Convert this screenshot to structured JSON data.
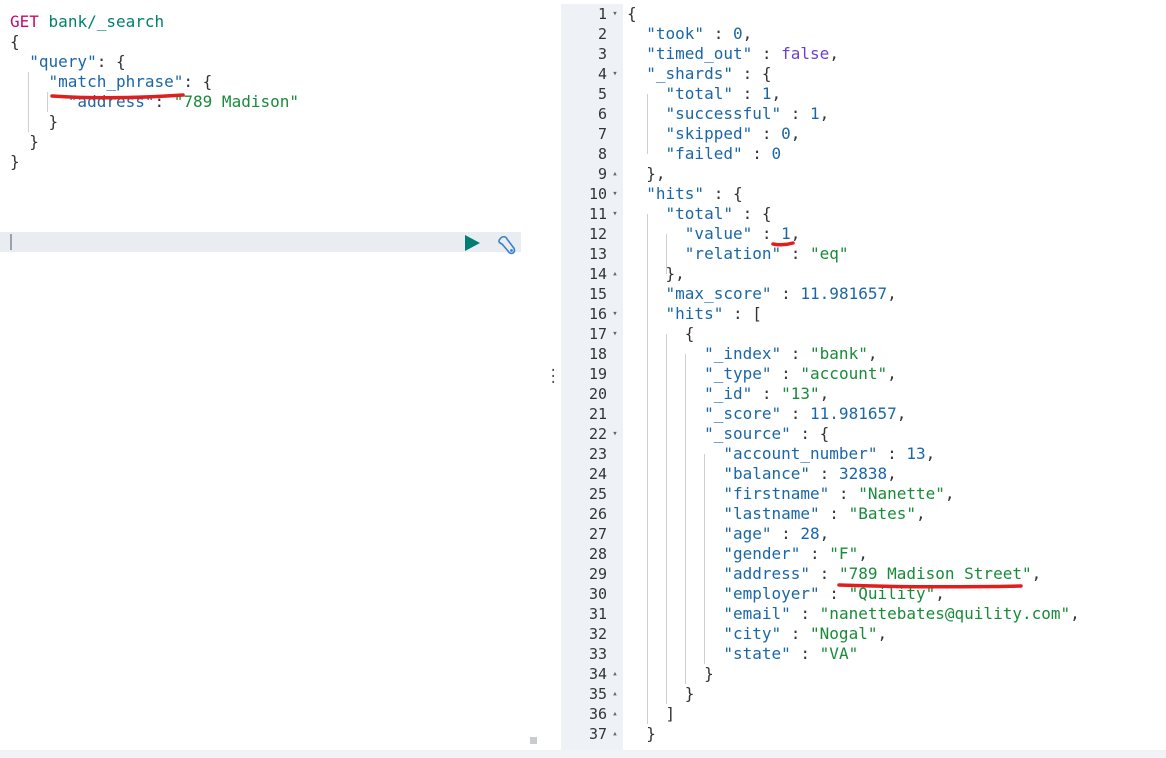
{
  "request": {
    "method": "GET",
    "path": "bank/_search",
    "lines": [
      [
        {
          "t": "{",
          "c": "punc"
        }
      ],
      [
        {
          "t": "  "
        },
        {
          "t": "\"query\"",
          "c": "key"
        },
        {
          "t": ": {",
          "c": "punc"
        }
      ],
      [
        {
          "t": "    "
        },
        {
          "t": "\"match_phrase\"",
          "c": "key"
        },
        {
          "t": ": {",
          "c": "punc"
        }
      ],
      [
        {
          "t": "      "
        },
        {
          "t": "\"address\"",
          "c": "key"
        },
        {
          "t": ": ",
          "c": "punc"
        },
        {
          "t": "\"789 Madison\"",
          "c": "str"
        }
      ],
      [
        {
          "t": "    }",
          "c": "punc"
        }
      ],
      [
        {
          "t": "  }",
          "c": "punc"
        }
      ],
      [
        {
          "t": "}",
          "c": "punc"
        }
      ]
    ]
  },
  "actions": {
    "run_icon": "play-icon",
    "settings_icon": "wrench-icon"
  },
  "response": {
    "lines": [
      {
        "n": "1",
        "fold": "down",
        "seg": [
          {
            "t": "{",
            "c": "punc"
          }
        ]
      },
      {
        "n": "2",
        "seg": [
          {
            "t": "  "
          },
          {
            "t": "\"took\"",
            "c": "key"
          },
          {
            "t": " : ",
            "c": "punc"
          },
          {
            "t": "0",
            "c": "num"
          },
          {
            "t": ",",
            "c": "punc"
          }
        ]
      },
      {
        "n": "3",
        "seg": [
          {
            "t": "  "
          },
          {
            "t": "\"timed_out\"",
            "c": "key"
          },
          {
            "t": " : ",
            "c": "punc"
          },
          {
            "t": "false",
            "c": "bool"
          },
          {
            "t": ",",
            "c": "punc"
          }
        ]
      },
      {
        "n": "4",
        "fold": "down",
        "seg": [
          {
            "t": "  "
          },
          {
            "t": "\"_shards\"",
            "c": "key"
          },
          {
            "t": " : {",
            "c": "punc"
          }
        ]
      },
      {
        "n": "5",
        "seg": [
          {
            "t": "    "
          },
          {
            "t": "\"total\"",
            "c": "key"
          },
          {
            "t": " : ",
            "c": "punc"
          },
          {
            "t": "1",
            "c": "num"
          },
          {
            "t": ",",
            "c": "punc"
          }
        ]
      },
      {
        "n": "6",
        "seg": [
          {
            "t": "    "
          },
          {
            "t": "\"successful\"",
            "c": "key"
          },
          {
            "t": " : ",
            "c": "punc"
          },
          {
            "t": "1",
            "c": "num"
          },
          {
            "t": ",",
            "c": "punc"
          }
        ]
      },
      {
        "n": "7",
        "seg": [
          {
            "t": "    "
          },
          {
            "t": "\"skipped\"",
            "c": "key"
          },
          {
            "t": " : ",
            "c": "punc"
          },
          {
            "t": "0",
            "c": "num"
          },
          {
            "t": ",",
            "c": "punc"
          }
        ]
      },
      {
        "n": "8",
        "seg": [
          {
            "t": "    "
          },
          {
            "t": "\"failed\"",
            "c": "key"
          },
          {
            "t": " : ",
            "c": "punc"
          },
          {
            "t": "0",
            "c": "num"
          }
        ]
      },
      {
        "n": "9",
        "fold": "up",
        "seg": [
          {
            "t": "  },",
            "c": "punc"
          }
        ]
      },
      {
        "n": "10",
        "fold": "down",
        "seg": [
          {
            "t": "  "
          },
          {
            "t": "\"hits\"",
            "c": "key"
          },
          {
            "t": " : {",
            "c": "punc"
          }
        ]
      },
      {
        "n": "11",
        "fold": "down",
        "seg": [
          {
            "t": "    "
          },
          {
            "t": "\"total\"",
            "c": "key"
          },
          {
            "t": " : {",
            "c": "punc"
          }
        ]
      },
      {
        "n": "12",
        "seg": [
          {
            "t": "      "
          },
          {
            "t": "\"value\"",
            "c": "key"
          },
          {
            "t": " : ",
            "c": "punc"
          },
          {
            "t": "1",
            "c": "num"
          },
          {
            "t": ",",
            "c": "punc"
          }
        ]
      },
      {
        "n": "13",
        "seg": [
          {
            "t": "      "
          },
          {
            "t": "\"relation\"",
            "c": "key"
          },
          {
            "t": " : ",
            "c": "punc"
          },
          {
            "t": "\"eq\"",
            "c": "str"
          }
        ]
      },
      {
        "n": "14",
        "fold": "up",
        "seg": [
          {
            "t": "    },",
            "c": "punc"
          }
        ]
      },
      {
        "n": "15",
        "seg": [
          {
            "t": "    "
          },
          {
            "t": "\"max_score\"",
            "c": "key"
          },
          {
            "t": " : ",
            "c": "punc"
          },
          {
            "t": "11.981657",
            "c": "num"
          },
          {
            "t": ",",
            "c": "punc"
          }
        ]
      },
      {
        "n": "16",
        "fold": "down",
        "seg": [
          {
            "t": "    "
          },
          {
            "t": "\"hits\"",
            "c": "key"
          },
          {
            "t": " : [",
            "c": "punc"
          }
        ]
      },
      {
        "n": "17",
        "fold": "down",
        "seg": [
          {
            "t": "      {",
            "c": "punc"
          }
        ]
      },
      {
        "n": "18",
        "seg": [
          {
            "t": "        "
          },
          {
            "t": "\"_index\"",
            "c": "key"
          },
          {
            "t": " : ",
            "c": "punc"
          },
          {
            "t": "\"bank\"",
            "c": "str"
          },
          {
            "t": ",",
            "c": "punc"
          }
        ]
      },
      {
        "n": "19",
        "seg": [
          {
            "t": "        "
          },
          {
            "t": "\"_type\"",
            "c": "key"
          },
          {
            "t": " : ",
            "c": "punc"
          },
          {
            "t": "\"account\"",
            "c": "str"
          },
          {
            "t": ",",
            "c": "punc"
          }
        ]
      },
      {
        "n": "20",
        "seg": [
          {
            "t": "        "
          },
          {
            "t": "\"_id\"",
            "c": "key"
          },
          {
            "t": " : ",
            "c": "punc"
          },
          {
            "t": "\"13\"",
            "c": "str"
          },
          {
            "t": ",",
            "c": "punc"
          }
        ]
      },
      {
        "n": "21",
        "seg": [
          {
            "t": "        "
          },
          {
            "t": "\"_score\"",
            "c": "key"
          },
          {
            "t": " : ",
            "c": "punc"
          },
          {
            "t": "11.981657",
            "c": "num"
          },
          {
            "t": ",",
            "c": "punc"
          }
        ]
      },
      {
        "n": "22",
        "fold": "down",
        "seg": [
          {
            "t": "        "
          },
          {
            "t": "\"_source\"",
            "c": "key"
          },
          {
            "t": " : {",
            "c": "punc"
          }
        ]
      },
      {
        "n": "23",
        "seg": [
          {
            "t": "          "
          },
          {
            "t": "\"account_number\"",
            "c": "key"
          },
          {
            "t": " : ",
            "c": "punc"
          },
          {
            "t": "13",
            "c": "num"
          },
          {
            "t": ",",
            "c": "punc"
          }
        ]
      },
      {
        "n": "24",
        "seg": [
          {
            "t": "          "
          },
          {
            "t": "\"balance\"",
            "c": "key"
          },
          {
            "t": " : ",
            "c": "punc"
          },
          {
            "t": "32838",
            "c": "num"
          },
          {
            "t": ",",
            "c": "punc"
          }
        ]
      },
      {
        "n": "25",
        "seg": [
          {
            "t": "          "
          },
          {
            "t": "\"firstname\"",
            "c": "key"
          },
          {
            "t": " : ",
            "c": "punc"
          },
          {
            "t": "\"Nanette\"",
            "c": "str"
          },
          {
            "t": ",",
            "c": "punc"
          }
        ]
      },
      {
        "n": "26",
        "seg": [
          {
            "t": "          "
          },
          {
            "t": "\"lastname\"",
            "c": "key"
          },
          {
            "t": " : ",
            "c": "punc"
          },
          {
            "t": "\"Bates\"",
            "c": "str"
          },
          {
            "t": ",",
            "c": "punc"
          }
        ]
      },
      {
        "n": "27",
        "seg": [
          {
            "t": "          "
          },
          {
            "t": "\"age\"",
            "c": "key"
          },
          {
            "t": " : ",
            "c": "punc"
          },
          {
            "t": "28",
            "c": "num"
          },
          {
            "t": ",",
            "c": "punc"
          }
        ]
      },
      {
        "n": "28",
        "seg": [
          {
            "t": "          "
          },
          {
            "t": "\"gender\"",
            "c": "key"
          },
          {
            "t": " : ",
            "c": "punc"
          },
          {
            "t": "\"F\"",
            "c": "str"
          },
          {
            "t": ",",
            "c": "punc"
          }
        ]
      },
      {
        "n": "29",
        "seg": [
          {
            "t": "          "
          },
          {
            "t": "\"address\"",
            "c": "key"
          },
          {
            "t": " : ",
            "c": "punc"
          },
          {
            "t": "\"789 Madison Street\"",
            "c": "str"
          },
          {
            "t": ",",
            "c": "punc"
          }
        ]
      },
      {
        "n": "30",
        "seg": [
          {
            "t": "          "
          },
          {
            "t": "\"employer\"",
            "c": "key"
          },
          {
            "t": " : ",
            "c": "punc"
          },
          {
            "t": "\"Quility\"",
            "c": "str"
          },
          {
            "t": ",",
            "c": "punc"
          }
        ]
      },
      {
        "n": "31",
        "seg": [
          {
            "t": "          "
          },
          {
            "t": "\"email\"",
            "c": "key"
          },
          {
            "t": " : ",
            "c": "punc"
          },
          {
            "t": "\"nanettebates@quility.com\"",
            "c": "str"
          },
          {
            "t": ",",
            "c": "punc"
          }
        ]
      },
      {
        "n": "32",
        "seg": [
          {
            "t": "          "
          },
          {
            "t": "\"city\"",
            "c": "key"
          },
          {
            "t": " : ",
            "c": "punc"
          },
          {
            "t": "\"Nogal\"",
            "c": "str"
          },
          {
            "t": ",",
            "c": "punc"
          }
        ]
      },
      {
        "n": "33",
        "seg": [
          {
            "t": "          "
          },
          {
            "t": "\"state\"",
            "c": "key"
          },
          {
            "t": " : ",
            "c": "punc"
          },
          {
            "t": "\"VA\"",
            "c": "str"
          }
        ]
      },
      {
        "n": "34",
        "fold": "up",
        "seg": [
          {
            "t": "        }",
            "c": "punc"
          }
        ]
      },
      {
        "n": "35",
        "fold": "up",
        "seg": [
          {
            "t": "      }",
            "c": "punc"
          }
        ]
      },
      {
        "n": "36",
        "fold": "up",
        "seg": [
          {
            "t": "    ]",
            "c": "punc"
          }
        ]
      },
      {
        "n": "37",
        "fold": "up",
        "seg": [
          {
            "t": "  }",
            "c": "punc"
          }
        ]
      }
    ]
  },
  "colors": {
    "method": "#c80a68",
    "url": "#00806f",
    "key": "#1a66a8",
    "string": "#188b38",
    "boolean": "#6a3fd1",
    "run_button": "#017d73",
    "annotation": "#e01e1e"
  }
}
